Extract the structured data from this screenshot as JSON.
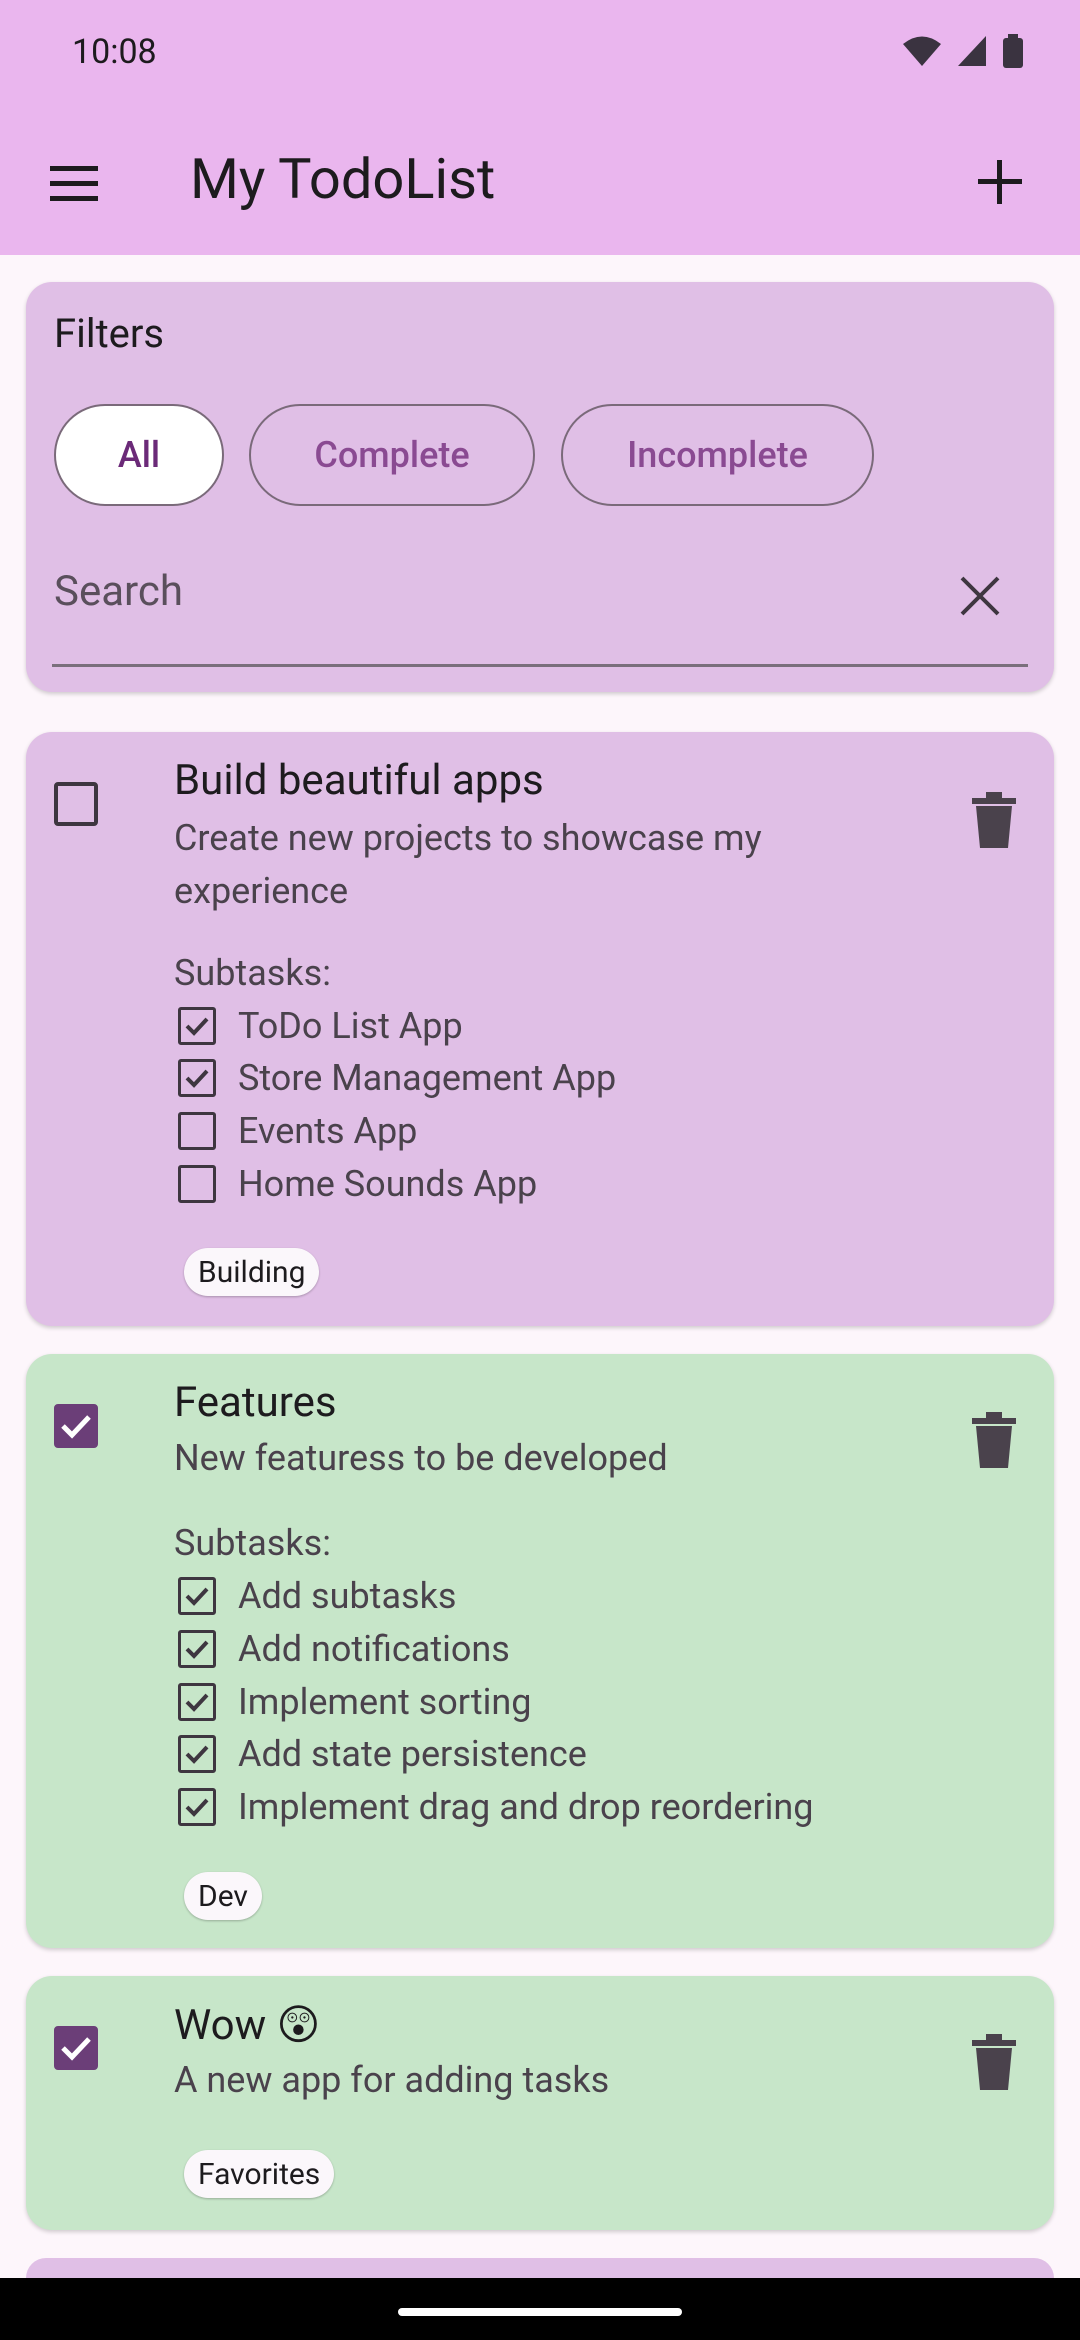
{
  "status_bar": {
    "time": "10:08"
  },
  "app_bar": {
    "title": "My TodoList"
  },
  "filters": {
    "title": "Filters",
    "chips": [
      "All",
      "Complete",
      "Incomplete"
    ],
    "selected": "All",
    "search_placeholder": "Search"
  },
  "todos": [
    {
      "title": "Build beautiful apps",
      "description": "Create new projects to showcase my experience",
      "completed": false,
      "subtasks_label": "Subtasks:",
      "subtasks": [
        {
          "label": "ToDo List App",
          "done": true
        },
        {
          "label": "Store Management App",
          "done": true
        },
        {
          "label": "Events App",
          "done": false
        },
        {
          "label": "Home Sounds App",
          "done": false
        }
      ],
      "tag": "Building"
    },
    {
      "title": "Features",
      "description": "New featuress to be developed",
      "completed": true,
      "subtasks_label": "Subtasks:",
      "subtasks": [
        {
          "label": "Add subtasks",
          "done": true
        },
        {
          "label": "Add notifications",
          "done": true
        },
        {
          "label": "Implement sorting",
          "done": true
        },
        {
          "label": "Add state persistence",
          "done": true
        },
        {
          "label": "Implement drag and drop reordering",
          "done": true
        }
      ],
      "tag": "Dev"
    },
    {
      "title": "Wow 😲",
      "description": "A new app for adding tasks",
      "completed": true,
      "tag": "Favorites"
    }
  ],
  "colors": {
    "app_bar": "#eab6ee",
    "incomplete_card": "#e0bfe6",
    "complete_card": "#c7e6c9",
    "accent": "#6b3e78"
  }
}
